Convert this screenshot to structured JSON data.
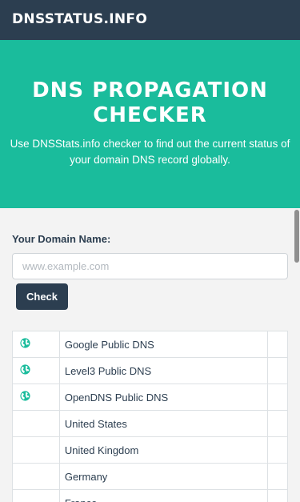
{
  "navbar": {
    "brand": "DNSSTATUS.INFO"
  },
  "hero": {
    "title": "DNS PROPAGATION CHECKER",
    "description": "Use DNSStats.info checker to find out the current status of your domain DNS record globally."
  },
  "form": {
    "label": "Your Domain Name:",
    "placeholder": "www.example.com",
    "value": "",
    "button_label": "Check"
  },
  "colors": {
    "navbar": "#2c3e50",
    "hero": "#1abc9c",
    "button": "#2c3e50"
  },
  "results": [
    {
      "icon": "globe-icon",
      "name": "Google Public DNS",
      "status": ""
    },
    {
      "icon": "globe-icon",
      "name": "Level3 Public DNS",
      "status": ""
    },
    {
      "icon": "globe-icon",
      "name": "OpenDNS Public DNS",
      "status": ""
    },
    {
      "icon": "",
      "name": "United States",
      "status": ""
    },
    {
      "icon": "",
      "name": "United Kingdom",
      "status": ""
    },
    {
      "icon": "",
      "name": "Germany",
      "status": ""
    },
    {
      "icon": "",
      "name": "France",
      "status": ""
    }
  ]
}
